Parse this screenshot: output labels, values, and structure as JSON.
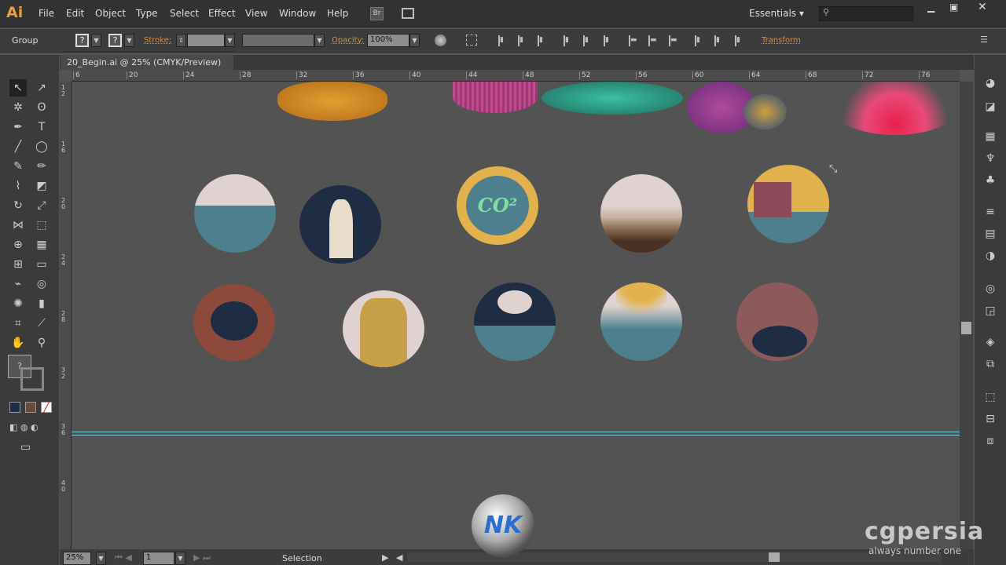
{
  "app": {
    "logo": "Ai",
    "menus": [
      "File",
      "Edit",
      "Object",
      "Type",
      "Select",
      "Effect",
      "View",
      "Window",
      "Help"
    ],
    "bridge": "Br",
    "workspace": "Essentials",
    "search_placeholder": ""
  },
  "control": {
    "selection_type": "Group",
    "fill": "?",
    "stroke_swatch": "?",
    "stroke_label": "Stroke:",
    "opacity_label": "Opacity:",
    "opacity_value": "100%",
    "transform_label": "Transform"
  },
  "document": {
    "tab_title": "20_Begin.ai @ 25% (CMYK/Preview)",
    "close": "×"
  },
  "ruler": {
    "h_ticks": [
      "6",
      "20",
      "24",
      "28",
      "32",
      "36",
      "40",
      "44",
      "48",
      "52",
      "56",
      "60",
      "64",
      "68",
      "72",
      "76"
    ],
    "v_ticks": [
      "12",
      "16",
      "20",
      "24",
      "28",
      "32",
      "36",
      "40"
    ]
  },
  "status": {
    "zoom": "25%",
    "artboard": "1",
    "tool": "Selection"
  },
  "watermark": {
    "brand": "cgpersia",
    "tagline": "always number one",
    "logo": "NK"
  },
  "icons": {
    "co2_text": "CO²"
  },
  "colors": {
    "canvas": "#535353",
    "guide": "#7fd0e0",
    "navy": "#1f2d44",
    "teal": "#4e7f8c",
    "mustard": "#e2b24c",
    "rust": "#8d4a3c",
    "blush": "#e0d2d0"
  }
}
